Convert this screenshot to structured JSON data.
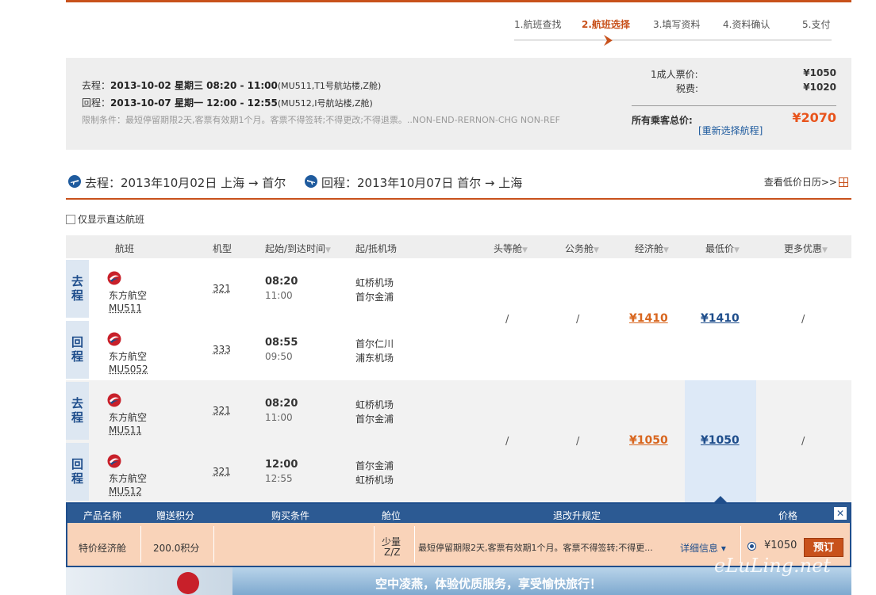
{
  "steps": [
    "1.航班查找",
    "2.航班选择",
    "3.填写资料",
    "4.资料确认",
    "5.支付"
  ],
  "summary": {
    "outbound_prefix": "去程：",
    "outbound_main": "2013-10-02  星期三  08:20 - 11:00",
    "outbound_detail": "(MU511,T1号航站楼,Z舱)",
    "return_prefix": "回程：",
    "return_main": "2013-10-07  星期一  12:00 - 12:55",
    "return_detail": "(MU512,I号航站楼,Z舱)",
    "restriction": "限制条件：最短停留期限2天,客票有效期1个月。客票不得签转;不得更改;不得退票。..NON-END-RERNON-CHG NON-REF",
    "adult_label": "1成人票价:",
    "adult_value": "¥1050",
    "tax_label": "税费:",
    "tax_value": "¥1020",
    "total_label": "所有乘客总价:",
    "total_value": "¥2070",
    "reselect": "[重新选择航程]"
  },
  "route": {
    "outbound": "去程：2013年10月02日 上海 → 首尔",
    "return": "回程：2013年10月07日 首尔 → 上海",
    "calendar_link": "查看低价日历>>"
  },
  "direct_only": "仅显示直达航班",
  "table_headers": {
    "flight": "航班",
    "plane": "机型",
    "time": "起始/到达时间",
    "airport": "起/抵机场",
    "first": "头等舱",
    "business": "公务舱",
    "economy": "经济舱",
    "lowest": "最低价",
    "more": "更多优惠"
  },
  "groups": [
    {
      "legs": [
        {
          "label": "去程",
          "airline": "东方航空",
          "flight": "MU511",
          "plane": "321",
          "dep": "08:20",
          "arr": "11:00",
          "from": "虹桥机场",
          "to": "首尔金浦"
        },
        {
          "label": "回程",
          "airline": "东方航空",
          "flight": "MU5052",
          "plane": "333",
          "dep": "08:55",
          "arr": "09:50",
          "from": "首尔仁川",
          "to": "浦东机场"
        }
      ],
      "first": "/",
      "business": "/",
      "economy": "¥1410",
      "lowest": "¥1410",
      "more": "/"
    },
    {
      "legs": [
        {
          "label": "去程",
          "airline": "东方航空",
          "flight": "MU511",
          "plane": "321",
          "dep": "08:20",
          "arr": "11:00",
          "from": "虹桥机场",
          "to": "首尔金浦"
        },
        {
          "label": "回程",
          "airline": "东方航空",
          "flight": "MU512",
          "plane": "321",
          "dep": "12:00",
          "arr": "12:55",
          "from": "首尔金浦",
          "to": "虹桥机场"
        }
      ],
      "first": "/",
      "business": "/",
      "economy": "¥1050",
      "lowest": "¥1050",
      "more": "/"
    }
  ],
  "detail": {
    "headers": {
      "product": "产品名称",
      "points": "赠送积分",
      "conditions": "购买条件",
      "seat": "舱位",
      "rules": "退改升规定",
      "price": "价格"
    },
    "product": "特价经济舱",
    "points": "200.0积分",
    "seat_qty": "少量",
    "seat_code": "Z/Z",
    "rules": "最短停留期限2天,客票有效期1个月。客票不得签转;不得更...",
    "more_info": "详细信息",
    "price": "¥1050",
    "book": "预订",
    "close": "✕"
  },
  "banner": {
    "slogan": "空中凌燕，体验优质服务，享受愉快旅行！"
  },
  "watermark": "eLuLing.net",
  "colors": {
    "accent": "#c8511b",
    "brand_blue": "#1f4e8c",
    "price_orange": "#d8661f"
  }
}
